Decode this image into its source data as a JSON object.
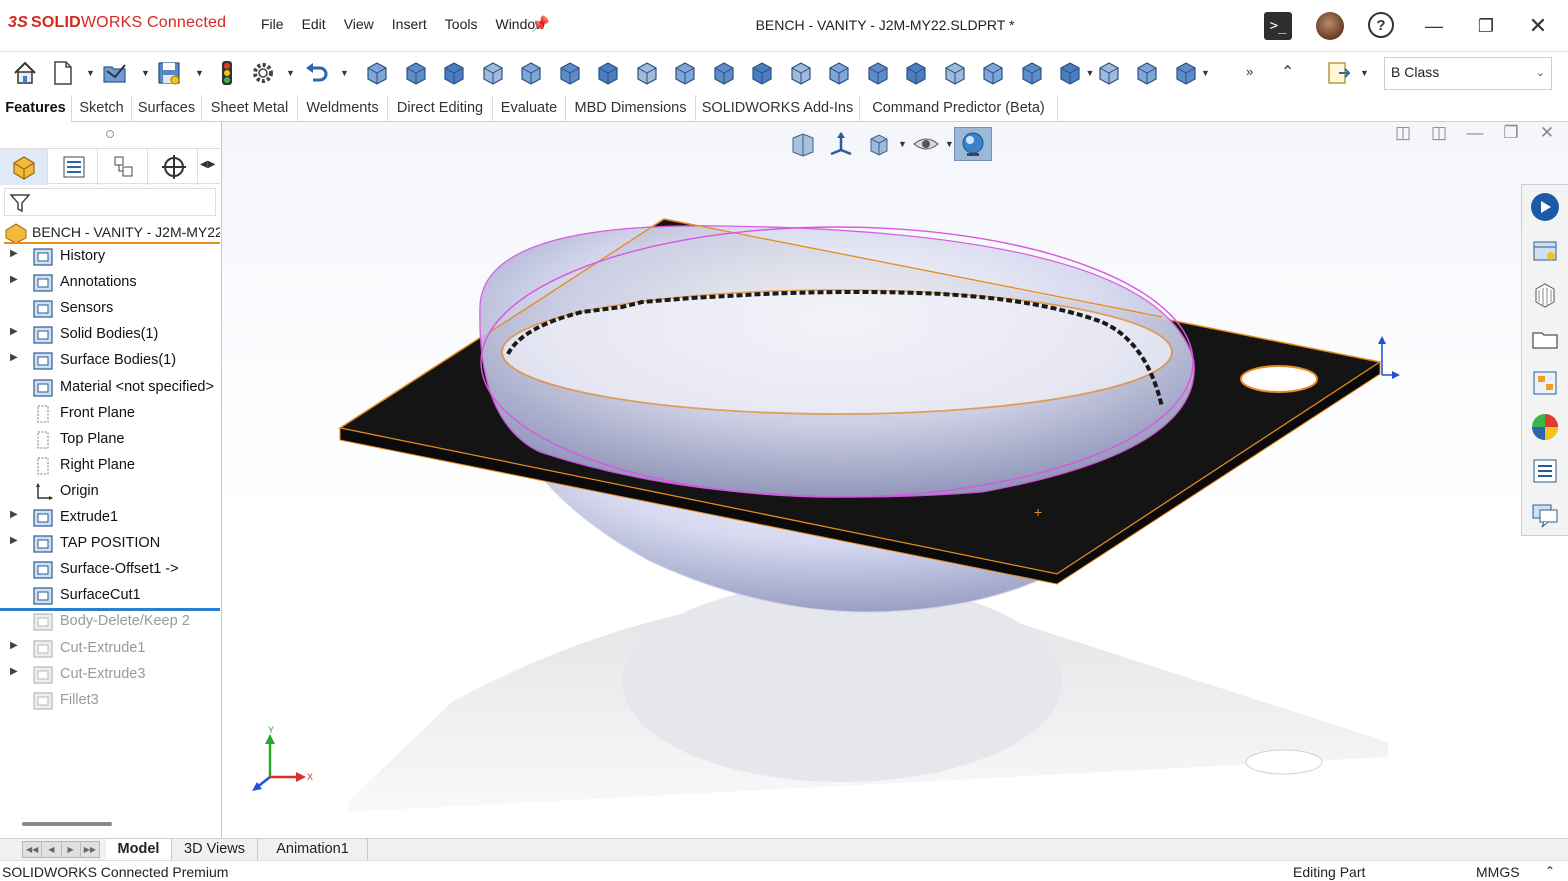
{
  "app": {
    "brand_ds": "3S",
    "brand_solid": "SOLID",
    "brand_works": "WORKS",
    "brand_connected": " Connected",
    "doc_title": "BENCH - VANITY  - J2M-MY22.SLDPRT *",
    "menu": [
      "File",
      "Edit",
      "View",
      "Insert",
      "Tools",
      "Window"
    ]
  },
  "toolbar": {
    "class_select": "B Class",
    "icons": [
      "home-icon",
      "new-document-icon",
      "select-icon",
      "save-icon",
      "rebuild-icon",
      "options-icon",
      "undo-icon",
      "extrude-icon",
      "revolve-icon",
      "sweep-icon",
      "loft-icon",
      "fillet-icon",
      "chamfer-icon",
      "rib-icon",
      "draft-icon",
      "shell-icon",
      "wrap-icon",
      "dome-icon",
      "reference-geometry-icon",
      "curves-icon",
      "instant3d-icon",
      "cylinder-icon",
      "cone-icon",
      "sphere-icon",
      "box-icon",
      "plane-icon",
      "axis-icon",
      "point-icon",
      "measure-icon"
    ]
  },
  "command_tabs": [
    "Features",
    "Sketch",
    "Surfaces",
    "Sheet Metal",
    "Weldments",
    "Direct Editing",
    "Evaluate",
    "MBD Dimensions",
    "SOLIDWORKS Add-Ins",
    "Command Predictor (Beta)"
  ],
  "tree": {
    "root": "BENCH - VANITY  - J2M-MY22",
    "items": [
      {
        "label": "History",
        "expand": true,
        "dim": false,
        "icon": "history-icon"
      },
      {
        "label": "Annotations",
        "expand": true,
        "dim": false,
        "icon": "annotations-icon"
      },
      {
        "label": "Sensors",
        "expand": false,
        "dim": false,
        "icon": "sensors-icon"
      },
      {
        "label": "Solid Bodies(1)",
        "expand": true,
        "dim": false,
        "icon": "solid-bodies-icon"
      },
      {
        "label": "Surface Bodies(1)",
        "expand": true,
        "dim": false,
        "icon": "surface-bodies-icon"
      },
      {
        "label": "Material <not specified>",
        "expand": false,
        "dim": false,
        "icon": "material-icon"
      },
      {
        "label": "Front Plane",
        "expand": false,
        "dim": false,
        "icon": "plane-icon"
      },
      {
        "label": "Top Plane",
        "expand": false,
        "dim": false,
        "icon": "plane-icon"
      },
      {
        "label": "Right Plane",
        "expand": false,
        "dim": false,
        "icon": "plane-icon"
      },
      {
        "label": "Origin",
        "expand": false,
        "dim": false,
        "icon": "origin-icon"
      },
      {
        "label": "Extrude1",
        "expand": true,
        "dim": false,
        "icon": "extrude-feature-icon"
      },
      {
        "label": "TAP POSITION",
        "expand": true,
        "dim": false,
        "icon": "sketch-icon"
      },
      {
        "label": "Surface-Offset1 ->",
        "expand": false,
        "dim": false,
        "icon": "surface-offset-icon"
      },
      {
        "label": "SurfaceCut1",
        "expand": false,
        "dim": false,
        "icon": "surface-cut-icon"
      },
      {
        "label": "Body-Delete/Keep 2",
        "expand": false,
        "dim": true,
        "icon": "body-delete-icon"
      },
      {
        "label": "Cut-Extrude1",
        "expand": true,
        "dim": true,
        "icon": "cut-extrude-icon"
      },
      {
        "label": "Cut-Extrude3",
        "expand": true,
        "dim": true,
        "icon": "cut-extrude-icon"
      },
      {
        "label": "Fillet3",
        "expand": false,
        "dim": true,
        "icon": "fillet-feature-icon"
      }
    ]
  },
  "triad": {
    "x": "X",
    "y": "Y"
  },
  "bottom_tabs": [
    "Model",
    "3D Views",
    "Animation1"
  ],
  "status": {
    "product": "SOLIDWORKS Connected Premium",
    "mode": "Editing Part",
    "units": "MMGS"
  },
  "colors": {
    "brand_red": "#d7261e",
    "selection_orange": "#e78b1e",
    "edge_magenta": "#d957e0",
    "plate_black": "#141414"
  }
}
